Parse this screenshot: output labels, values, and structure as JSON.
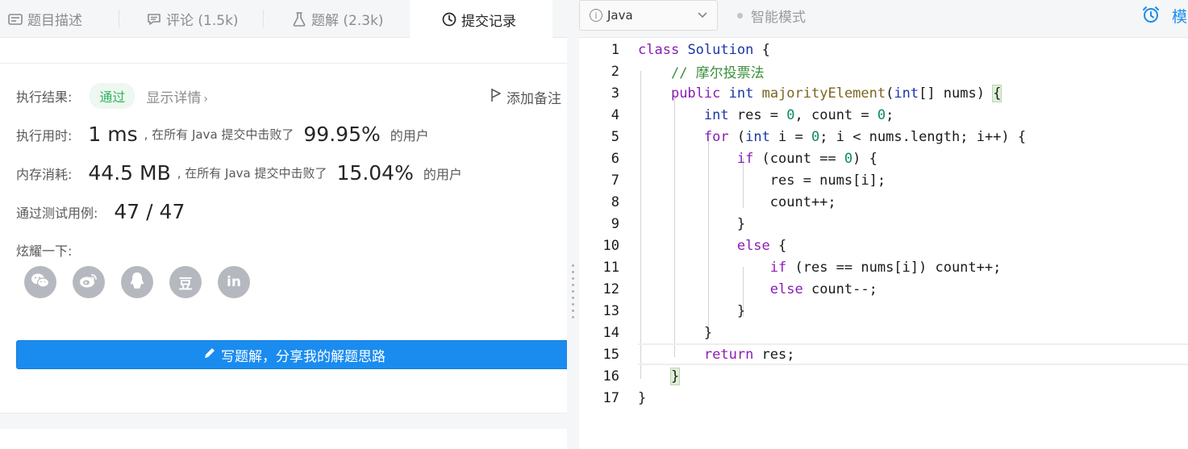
{
  "tabs": [
    {
      "label": "题目描述",
      "icon": "description-icon"
    },
    {
      "label": "评论 (1.5k)",
      "icon": "comment-icon"
    },
    {
      "label": "题解 (2.3k)",
      "icon": "flask-icon"
    },
    {
      "label": "提交记录",
      "icon": "clock-icon"
    }
  ],
  "result": {
    "exec_label": "执行结果:",
    "status": "通过",
    "detail_link": "显示详情",
    "add_note": "添加备注",
    "time_label": "执行用时:",
    "time_value": "1 ms",
    "time_mid": ", 在所有 Java 提交中击败了",
    "time_pct": "99.95%",
    "time_suffix": "的用户",
    "mem_label": "内存消耗:",
    "mem_value": "44.5 MB",
    "mem_mid": ", 在所有 Java 提交中击败了",
    "mem_pct": "15.04%",
    "mem_suffix": "的用户",
    "cases_label": "通过测试用例:",
    "cases_value": "47 / 47",
    "share_label": "炫耀一下:",
    "share_buttons": [
      {
        "name": "wechat",
        "glyph": "◕"
      },
      {
        "name": "weibo",
        "glyph": "◉"
      },
      {
        "name": "qq",
        "glyph": "♟"
      },
      {
        "name": "douban",
        "glyph": "豆"
      },
      {
        "name": "linkedin",
        "glyph": "in"
      }
    ],
    "write_button": "写题解，分享我的解题思路"
  },
  "toolbar": {
    "language": "Java",
    "smart_mode": "智能模式",
    "right_text": "模"
  },
  "code_lines": [
    {
      "n": "1"
    },
    {
      "n": "2"
    },
    {
      "n": "3"
    },
    {
      "n": "4"
    },
    {
      "n": "5"
    },
    {
      "n": "6"
    },
    {
      "n": "7"
    },
    {
      "n": "8"
    },
    {
      "n": "9"
    },
    {
      "n": "10"
    },
    {
      "n": "11"
    },
    {
      "n": "12"
    },
    {
      "n": "13"
    },
    {
      "n": "14"
    },
    {
      "n": "15"
    },
    {
      "n": "16"
    },
    {
      "n": "17"
    }
  ],
  "code_tokens": {
    "l1": [
      "class",
      " ",
      "Solution",
      " {"
    ],
    "l2": [
      "// 摩尔投票法"
    ],
    "l3": [
      "public",
      " ",
      "int",
      " ",
      "majorityElement",
      "(",
      "int",
      "[] nums) ",
      "{"
    ],
    "l4": [
      "int",
      " res = ",
      "0",
      ", count = ",
      "0",
      ";"
    ],
    "l5": [
      "for",
      " (",
      "int",
      " i = ",
      "0",
      "; i < nums.length; i++) {"
    ],
    "l6": [
      "if",
      " (count == ",
      "0",
      ") {"
    ],
    "l7": [
      "res = nums[i];"
    ],
    "l8": [
      "count++;"
    ],
    "l9": [
      "}"
    ],
    "l10": [
      "else",
      " {"
    ],
    "l11": [
      "if",
      " (res == nums[i]) count++;"
    ],
    "l12": [
      "else",
      " count--;"
    ],
    "l13": [
      "}"
    ],
    "l14": [
      "}"
    ],
    "l15": [
      "return",
      " res;"
    ],
    "l16": [
      "}"
    ],
    "l17": [
      "}"
    ]
  },
  "colors": {
    "keyword": "#8b1cb4",
    "type": "#1b36a6",
    "function": "#7a6620",
    "number": "#0d8a5e",
    "comment": "#3b8f3b",
    "accent": "#1a8cf0",
    "success": "#2db55d"
  }
}
